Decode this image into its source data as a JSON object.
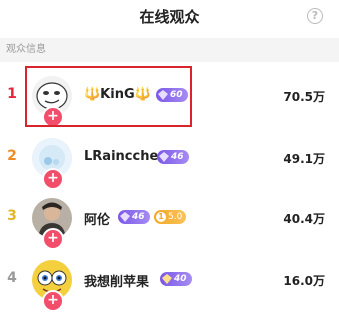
{
  "header": {
    "title": "在线观众",
    "help_icon": "question-icon"
  },
  "section": {
    "label": "观众信息"
  },
  "viewers": [
    {
      "rank": "1",
      "rank_color": "#e3263c",
      "name": "🔱KinG🔱",
      "level": "60",
      "fans_label": "",
      "score": "70.5万",
      "avatar": "meme-face"
    },
    {
      "rank": "2",
      "rank_color": "#f08a24",
      "name": "LRaincche",
      "level": "46",
      "fans_label": "",
      "score": "49.1万",
      "avatar": "cartoon-bubble"
    },
    {
      "rank": "3",
      "rank_color": "#e2b52a",
      "name": "阿伦",
      "level": "46",
      "fans_label": "5.0",
      "score": "40.4万",
      "avatar": "photo-person"
    },
    {
      "rank": "4",
      "rank_color": "#9a9a9a",
      "name": "我想削苹果",
      "level": "40",
      "fans_label": "",
      "score": "16.0万",
      "avatar": "sponge-face"
    }
  ],
  "colors": {
    "follow": "#f24e6b",
    "highlight": "#d9232d",
    "level_badge": "#7b58e8"
  }
}
